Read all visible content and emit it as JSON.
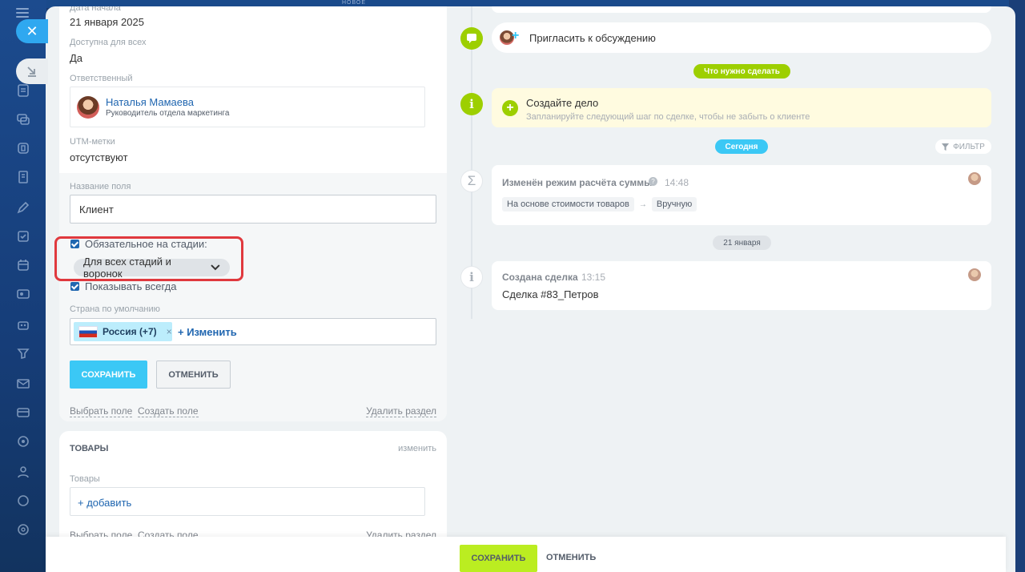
{
  "background": {
    "top_label": "НОВОЕ",
    "sidebar_icons": [
      "list-icon",
      "chat-icon",
      "folder-icon",
      "document-icon",
      "pen-icon",
      "checkbox-icon",
      "calendar-icon",
      "contact-icon",
      "robot-icon",
      "funnel-icon",
      "mail-icon",
      "card-icon",
      "target-icon",
      "people-icon",
      "help-icon",
      "settings-icon"
    ]
  },
  "details": {
    "start_date_label": "Дата начала",
    "start_date_value": "21 января 2025",
    "available_label": "Доступна для всех",
    "available_value": "Да",
    "responsible_label": "Ответственный",
    "responsible_name": "Наталья Мамаева",
    "responsible_position": "Руководитель отдела маркетинга",
    "utm_label": "UTM-метки",
    "utm_value": "отсутствуют"
  },
  "field_editor": {
    "field_name_label": "Название поля",
    "field_name_value": "Клиент",
    "required_label": "Обязательное на стадии:",
    "stage_option": "Для всех стадий и воронок",
    "show_always_label": "Показывать всегда",
    "default_country_label": "Страна по умолчанию",
    "country_tag": "Россия (+7)",
    "change_link": "+ Изменить",
    "save_label": "СОХРАНИТЬ",
    "cancel_label": "ОТМЕНИТЬ",
    "select_field": "Выбрать поле",
    "create_field": "Создать поле",
    "delete_section": "Удалить раздел"
  },
  "products": {
    "title": "ТОВАРЫ",
    "edit": "изменить",
    "label": "Товары",
    "add": "+ добавить",
    "select_field": "Выбрать поле",
    "create_field": "Создать поле",
    "delete_section": "Удалить раздел"
  },
  "timeline": {
    "invite": "Пригласить к обсуждению",
    "todo_pill": "Что нужно сделать",
    "create_task_title": "Создайте дело",
    "create_task_hint": "Запланируйте следующий шаг по сделке, чтобы не забыть о клиенте",
    "today_pill": "Сегодня",
    "filter": "ФИЛЬТР",
    "event1_title": "Изменён режим расчёта суммы",
    "event1_time": "14:48",
    "event1_from": "На основе стоимости товаров",
    "event1_arrow": "→",
    "event1_to": "Вручную",
    "date_pill": "21 января",
    "event2_title": "Создана сделка",
    "event2_time": "13:15",
    "event2_text": "Сделка #83_Петров"
  },
  "footer": {
    "save": "СОХРАНИТЬ",
    "cancel": "ОТМЕНИТЬ"
  }
}
